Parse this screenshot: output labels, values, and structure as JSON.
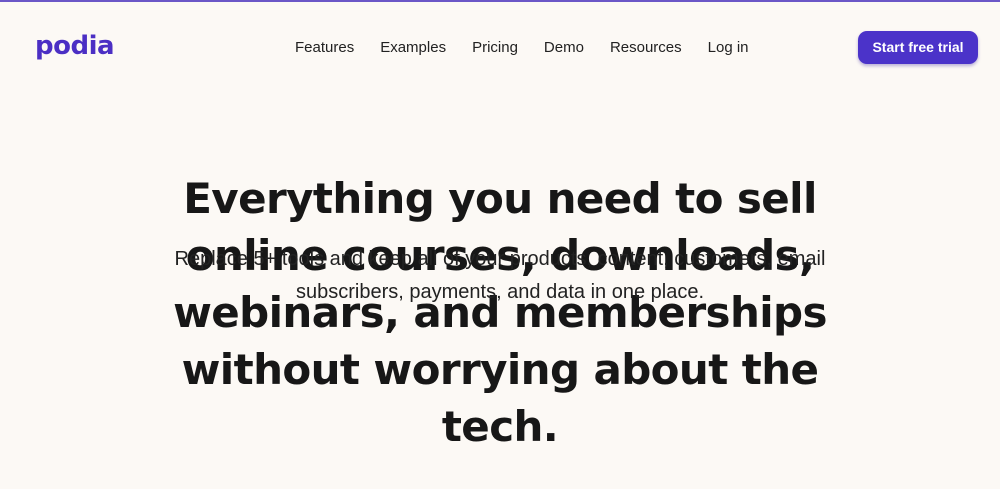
{
  "brand": {
    "name": "podia",
    "color": "#4b2fc4"
  },
  "nav": {
    "items": [
      {
        "label": "Features"
      },
      {
        "label": "Examples"
      },
      {
        "label": "Pricing"
      },
      {
        "label": "Demo"
      },
      {
        "label": "Resources"
      },
      {
        "label": "Log in"
      }
    ]
  },
  "header": {
    "cta_label": "Start free trial",
    "cta_color": "#4b33c9"
  },
  "hero": {
    "title": "Everything you need to sell online courses, downloads, webinars, and memberships without worrying about the tech.",
    "subtitle": "Replace 5+ tools and keep all of your products, content, customers, email subscribers, payments, and data in one place."
  },
  "theme": {
    "background": "#fcf9f5",
    "top_border": "#6b57c7"
  }
}
